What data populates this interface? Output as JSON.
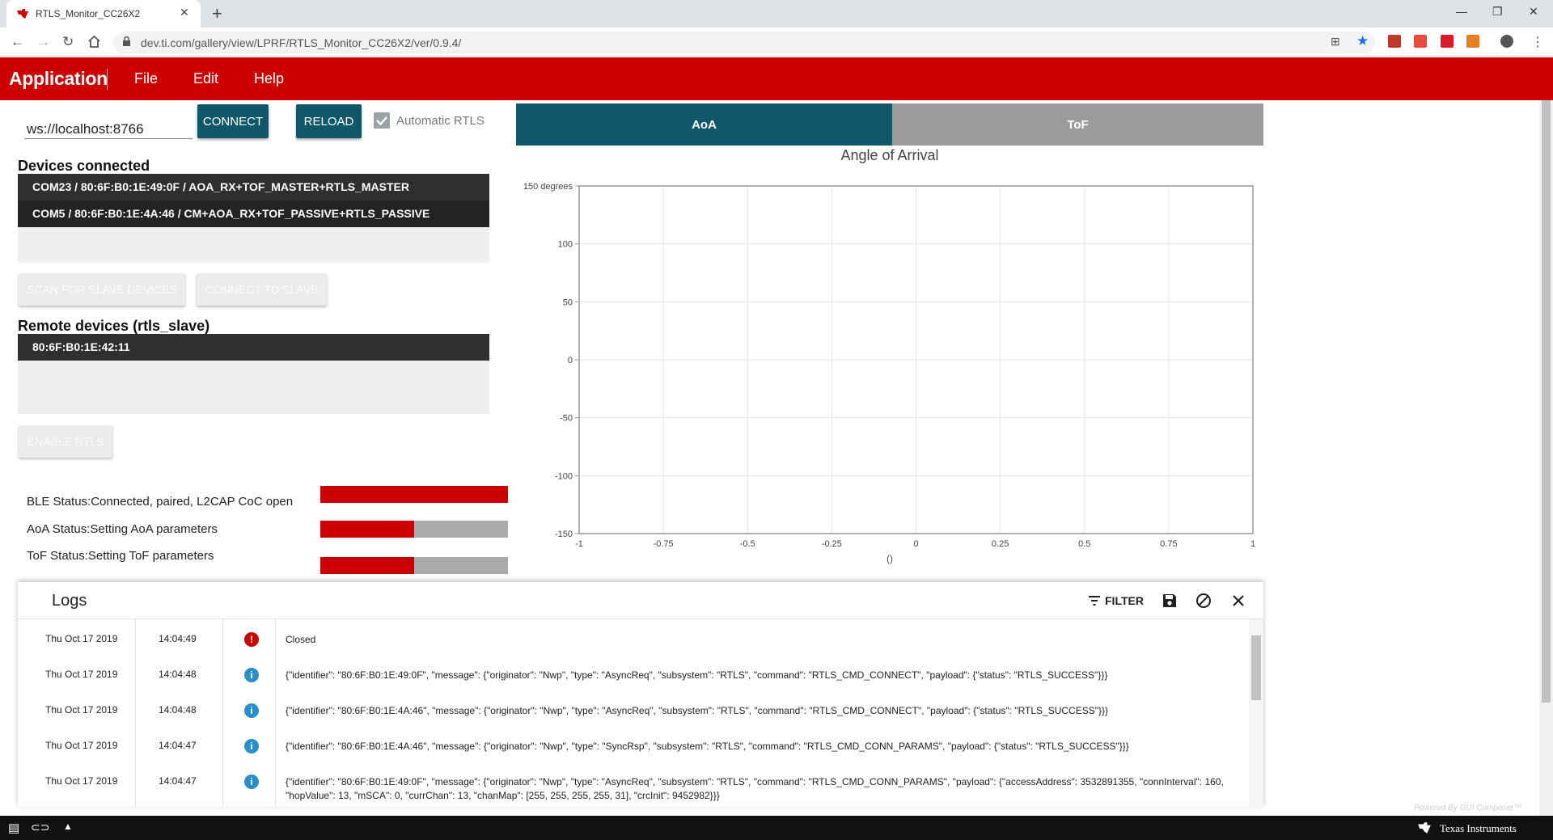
{
  "browser": {
    "tab_title": "RTLS_Monitor_CC26X2",
    "url": "dev.ti.com/gallery/view/LPRF/RTLS_Monitor_CC26X2/ver/0.9.4/"
  },
  "app": {
    "title": "Application",
    "menu": [
      "File",
      "Edit",
      "Help"
    ]
  },
  "connection": {
    "ws_url": "ws://localhost:8766",
    "connect_label": "CONNECT",
    "reload_label": "RELOAD",
    "auto_rtls_label": "Automatic RTLS",
    "auto_rtls_checked": true
  },
  "devices": {
    "title": "Devices connected",
    "items": [
      "COM23 / 80:6F:B0:1E:49:0F / AOA_RX+TOF_MASTER+RTLS_MASTER",
      "COM5 / 80:6F:B0:1E:4A:46 / CM+AOA_RX+TOF_PASSIVE+RTLS_PASSIVE"
    ],
    "scan_label": "SCAN FOR SLAVE DEVICES",
    "connect_slave_label": "CONNECT TO SLAVE"
  },
  "remote": {
    "title": "Remote devices (rtls_slave)",
    "items": [
      "80:6F:B0:1E:42:11"
    ],
    "enable_label": "ENABLE RTLS"
  },
  "status": [
    {
      "label": "BLE Status:Connected, paired, L2CAP CoC open",
      "progress": 1.0
    },
    {
      "label": "AoA Status:Setting AoA parameters",
      "progress": 0.5
    },
    {
      "label": "ToF Status:Setting ToF parameters",
      "progress": 0.5
    }
  ],
  "tabs": {
    "aoa": "AoA",
    "tof": "ToF"
  },
  "chart_data": {
    "type": "scatter",
    "title": "Angle of Arrival",
    "xlabel": "()",
    "ylabel": "",
    "xlim": [
      -1,
      1
    ],
    "ylim": [
      -150,
      150
    ],
    "x_ticks": [
      "-1",
      "-0.75",
      "-0.5",
      "-0.25",
      "0",
      "0.25",
      "0.5",
      "0.75",
      "1"
    ],
    "y_ticks": [
      "150 degrees",
      "100",
      "50",
      "0",
      "-50",
      "-100",
      "-150"
    ],
    "series": [],
    "grid": true
  },
  "logs": {
    "title": "Logs",
    "filter_label": "FILTER",
    "rows": [
      {
        "date": "Thu Oct 17 2019",
        "time": "14:04:49",
        "level": "error",
        "message": "Closed"
      },
      {
        "date": "Thu Oct 17 2019",
        "time": "14:04:48",
        "level": "info",
        "message": "{\"identifier\": \"80:6F:B0:1E:49:0F\", \"message\": {\"originator\": \"Nwp\", \"type\": \"AsyncReq\", \"subsystem\": \"RTLS\", \"command\": \"RTLS_CMD_CONNECT\", \"payload\": {\"status\": \"RTLS_SUCCESS\"}}}"
      },
      {
        "date": "Thu Oct 17 2019",
        "time": "14:04:48",
        "level": "info",
        "message": "{\"identifier\": \"80:6F:B0:1E:4A:46\", \"message\": {\"originator\": \"Nwp\", \"type\": \"AsyncReq\", \"subsystem\": \"RTLS\", \"command\": \"RTLS_CMD_CONNECT\", \"payload\": {\"status\": \"RTLS_SUCCESS\"}}}"
      },
      {
        "date": "Thu Oct 17 2019",
        "time": "14:04:47",
        "level": "info",
        "message": "{\"identifier\": \"80:6F:B0:1E:4A:46\", \"message\": {\"originator\": \"Nwp\", \"type\": \"SyncRsp\", \"subsystem\": \"RTLS\", \"command\": \"RTLS_CMD_CONN_PARAMS\", \"payload\": {\"status\": \"RTLS_SUCCESS\"}}}"
      },
      {
        "date": "Thu Oct 17 2019",
        "time": "14:04:47",
        "level": "info",
        "message": "{\"identifier\": \"80:6F:B0:1E:49:0F\", \"message\": {\"originator\": \"Nwp\", \"type\": \"AsyncReq\", \"subsystem\": \"RTLS\", \"command\": \"RTLS_CMD_CONN_PARAMS\", \"payload\": {\"accessAddress\": 3532891355, \"connInterval\": 160, \"hopValue\": 13, \"mSCA\": 0, \"currChan\": 13, \"chanMap\": [255, 255, 255, 255, 31], \"crcInit\": 9452982}}}"
      }
    ]
  },
  "footer": {
    "brand": "Texas Instruments",
    "powered_by": "Powered By GUI Composer™"
  },
  "colors": {
    "brand_red": "#cc0000",
    "teal": "#11576a",
    "gray_tab": "#9b9b9b",
    "info_blue": "#2a8fc7"
  }
}
